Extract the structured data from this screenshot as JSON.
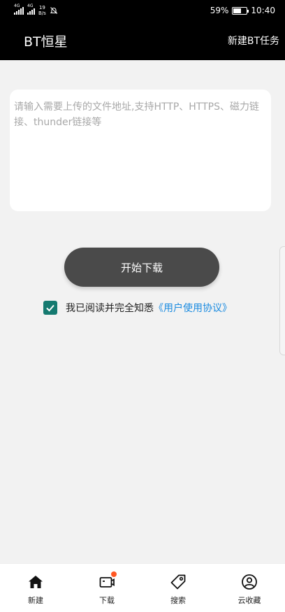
{
  "status_bar": {
    "sig1_tag": "4G",
    "sig2_tag": "4G",
    "net_speed_value": "19",
    "net_speed_unit": "B/s",
    "battery": "59%",
    "battery_level": 0.59,
    "time": "10:40"
  },
  "header": {
    "title": "BT恒星",
    "action": "新建BT任务"
  },
  "input": {
    "placeholder": "请输入需要上传的文件地址,支持HTTP、HTTPS、磁力链接、thunder链接等",
    "value": ""
  },
  "start_button": "开始下载",
  "agreement": {
    "checked": true,
    "text": "我已阅读并完全知悉",
    "link": "《用户使用协议》"
  },
  "bottom_nav": {
    "items": [
      {
        "label": "新建",
        "icon": "home-icon"
      },
      {
        "label": "下载",
        "icon": "download-camera-icon"
      },
      {
        "label": "搜索",
        "icon": "tag-icon"
      },
      {
        "label": "云收藏",
        "icon": "user-circle-icon"
      }
    ]
  },
  "colors": {
    "appbar_bg": "#000000",
    "button_bg": "#4a4a4a",
    "checkbox": "#157a70",
    "link": "#1a8be0",
    "badge": "#ff5722"
  }
}
